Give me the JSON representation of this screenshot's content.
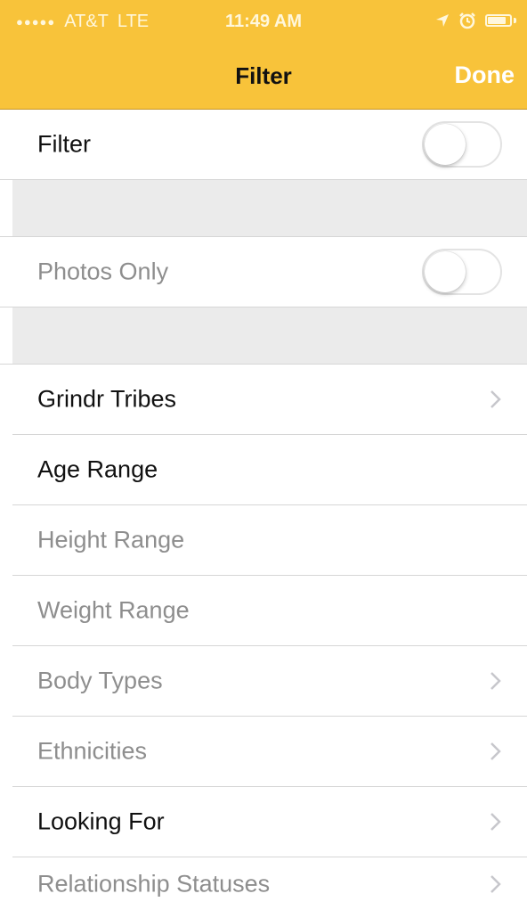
{
  "status_bar": {
    "signal": "●●●●●",
    "carrier": "AT&T",
    "network": "LTE",
    "time": "11:49 AM"
  },
  "nav": {
    "title": "Filter",
    "done_label": "Done"
  },
  "toggles": {
    "filter": {
      "label": "Filter",
      "on": false
    },
    "photos_only": {
      "label": "Photos Only",
      "on": false
    }
  },
  "list": {
    "grindr_tribes": "Grindr Tribes",
    "age_range": "Age Range",
    "height_range": "Height Range",
    "weight_range": "Weight Range",
    "body_types": "Body Types",
    "ethnicities": "Ethnicities",
    "looking_for": "Looking For",
    "relationship_statuses": "Relationship Statuses"
  },
  "colors": {
    "header": "#f8c33a",
    "primary_text": "#111111",
    "disabled_text": "#8e8e8e",
    "section_gap": "#ebebeb"
  }
}
